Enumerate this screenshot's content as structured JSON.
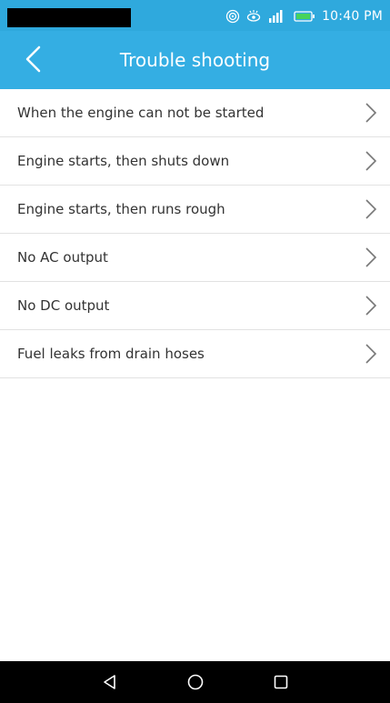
{
  "status_bar": {
    "time": "10:40 PM",
    "icons": [
      "hotspot-icon",
      "eye-comfort-icon",
      "signal-icon",
      "battery-icon"
    ]
  },
  "header": {
    "title": "Trouble shooting",
    "back_icon": "back-chevron-icon",
    "background": "#34aee3"
  },
  "menu": {
    "items": [
      {
        "label": "When the engine can not be started"
      },
      {
        "label": "Engine starts, then shuts down"
      },
      {
        "label": "Engine starts, then runs rough"
      },
      {
        "label": "No AC output"
      },
      {
        "label": "No DC output"
      },
      {
        "label": "Fuel leaks from drain hoses"
      }
    ],
    "chevron_icon": "chevron-right-icon"
  },
  "nav_bar": {
    "buttons": [
      "back-triangle-icon",
      "home-circle-icon",
      "recents-square-icon"
    ]
  }
}
